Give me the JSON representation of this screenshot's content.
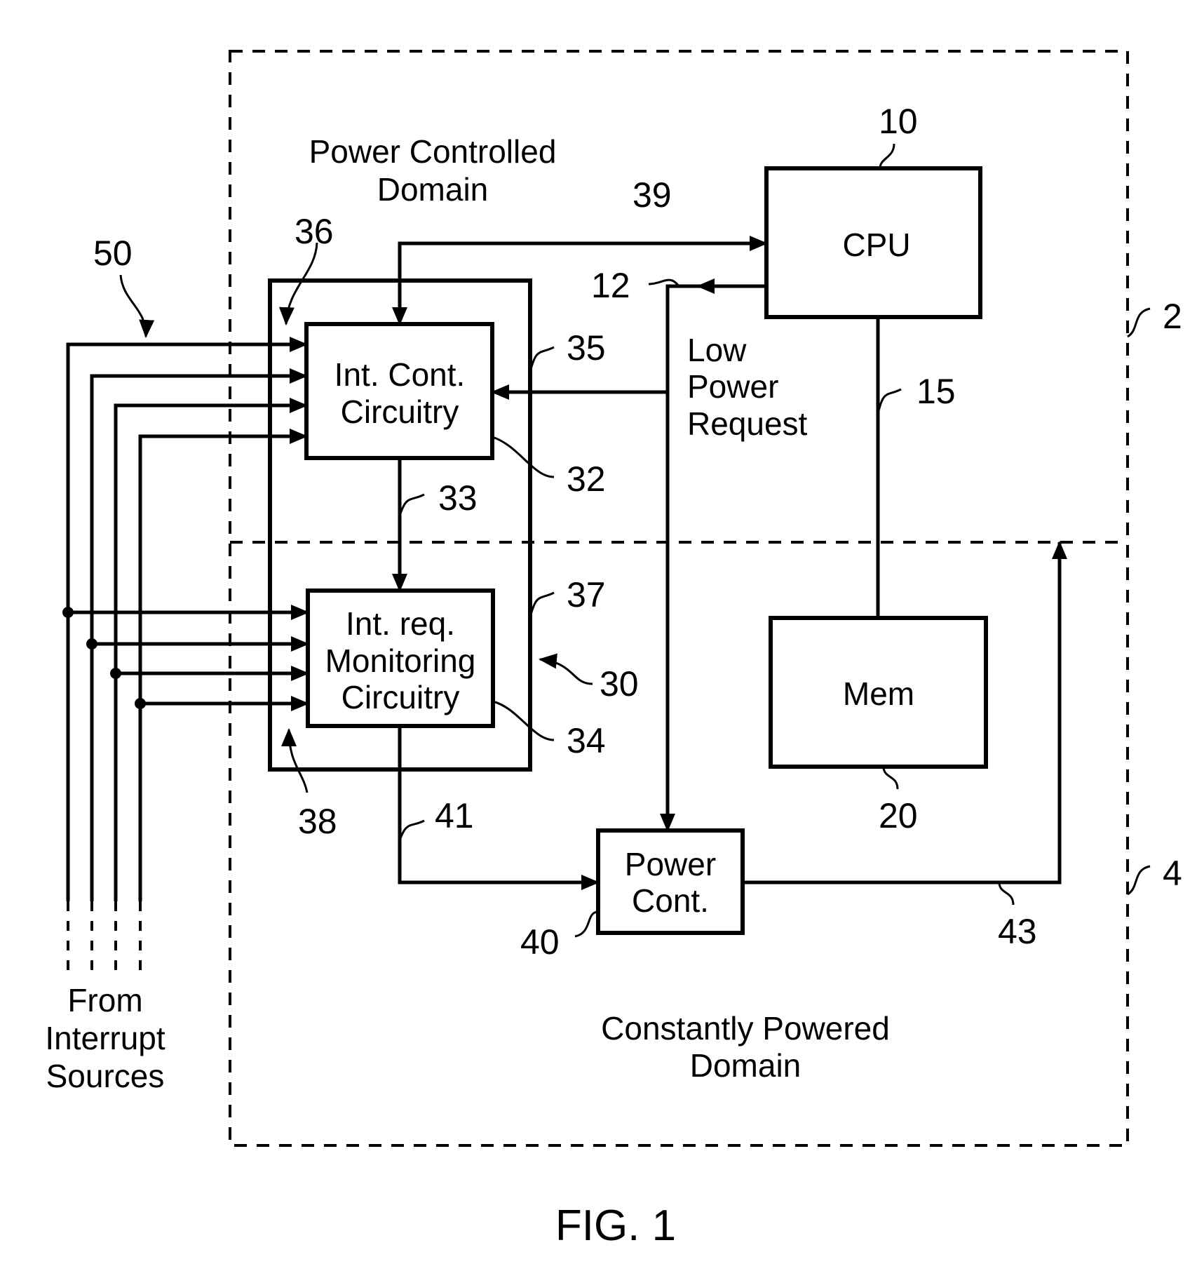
{
  "figure": {
    "caption": "FIG. 1",
    "domains": {
      "power_controlled": [
        "Power Controlled",
        "Domain"
      ],
      "constantly_powered": [
        "Constantly Powered",
        "Domain"
      ]
    },
    "blocks": {
      "cpu": {
        "label": [
          "CPU"
        ],
        "ref": "10"
      },
      "mem": {
        "label": [
          "Mem"
        ],
        "ref": "20"
      },
      "int_cont": {
        "label": [
          "Int. Cont.",
          "Circuitry"
        ],
        "ref": "32"
      },
      "int_req": {
        "label": [
          "Int. req.",
          "Monitoring",
          "Circuitry"
        ],
        "ref": "34"
      },
      "power_cont": {
        "label": [
          "Power",
          "Cont."
        ],
        "ref": "40"
      }
    },
    "signals": {
      "low_power_request": [
        "Low",
        "Power",
        "Request"
      ]
    },
    "interrupt_sources": [
      "From",
      "Interrupt",
      "Sources"
    ],
    "refs": {
      "domain_upper": "2",
      "domain_lower": "4",
      "cpu_link": "12",
      "bus": "15",
      "interrupt_controller": "30",
      "line_33": "33",
      "box_35": "35",
      "box_36": "36",
      "box_37": "37",
      "box_38": "38",
      "line_39": "39",
      "line_41": "41",
      "line_43": "43",
      "inputs_50": "50"
    }
  }
}
